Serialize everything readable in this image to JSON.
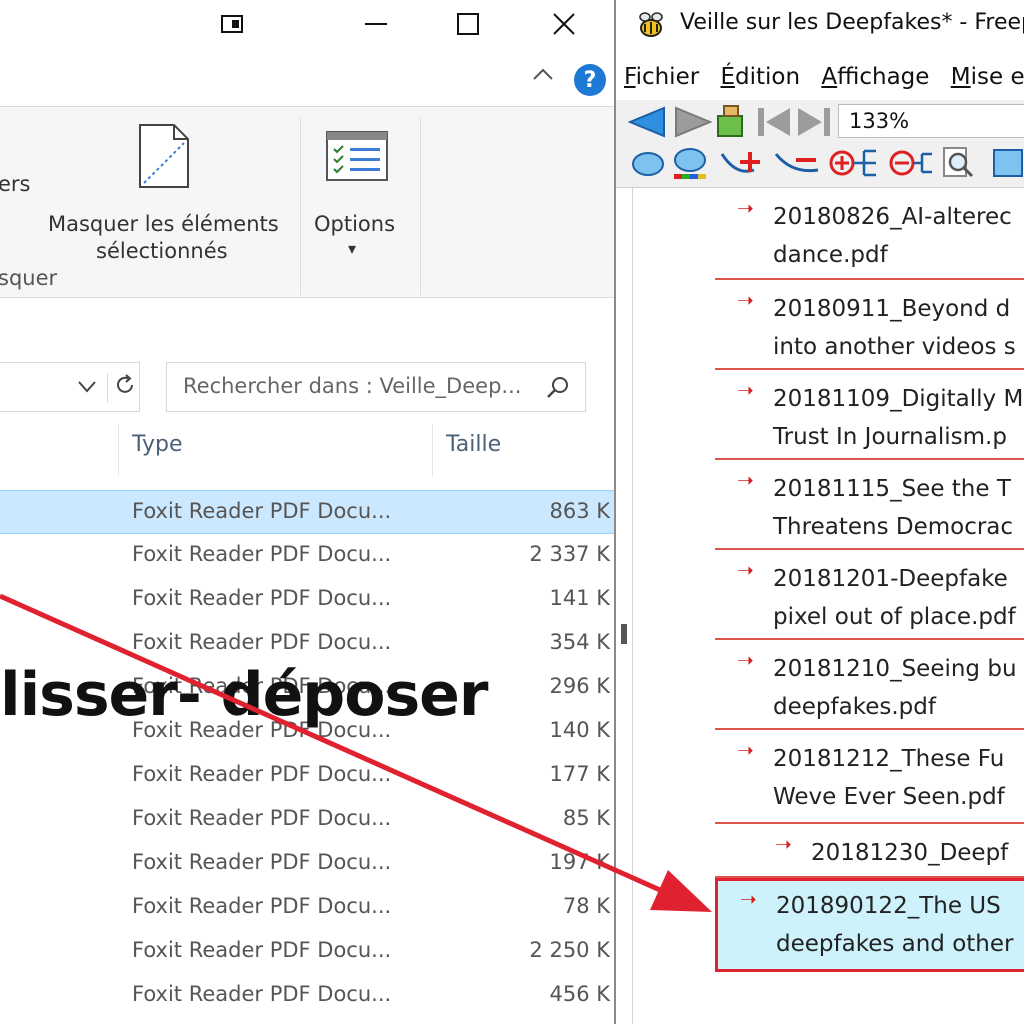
{
  "explorer": {
    "ribbon": {
      "partial_label": "ers",
      "hide_button_line1": "Masquer les éléments",
      "hide_button_line2": "sélectionnés",
      "group_label": "squer",
      "options_label": "Options",
      "options_caret": "▾"
    },
    "search": {
      "placeholder": "Rechercher dans : Veille_Deep..."
    },
    "columns": {
      "type": "Type",
      "size": "Taille"
    },
    "rows": [
      {
        "type": "Foxit Reader PDF Docu...",
        "size": "863 K",
        "selected": true
      },
      {
        "type": "Foxit Reader PDF Docu...",
        "size": "2 337 K"
      },
      {
        "type": "Foxit Reader PDF Docu...",
        "size": "141 K"
      },
      {
        "type": "Foxit Reader PDF Docu...",
        "size": "354 K"
      },
      {
        "type": "Foxit Reader PDF Docu...",
        "size": "296 K"
      },
      {
        "type": "Foxit Reader PDF Docu...",
        "size": "140 K"
      },
      {
        "type": "Foxit Reader PDF Docu...",
        "size": "177 K"
      },
      {
        "type": "Foxit Reader PDF Docu...",
        "size": "85 K"
      },
      {
        "type": "Foxit Reader PDF Docu...",
        "size": "197 K"
      },
      {
        "type": "Foxit Reader PDF Docu...",
        "size": "78 K"
      },
      {
        "type": "Foxit Reader PDF Docu...",
        "size": "2 250 K"
      },
      {
        "type": "Foxit Reader PDF Docu...",
        "size": "456 K"
      }
    ]
  },
  "overlay": {
    "drag_label": "lisser- déposer",
    "arrow_color": "#e0212f"
  },
  "freeplane": {
    "title": "Veille sur les Deepfakes* - Freep",
    "menu": [
      {
        "u": "F",
        "rest": "ichier"
      },
      {
        "u": "É",
        "rest": "dition"
      },
      {
        "u": "A",
        "rest": "ffichage"
      },
      {
        "u": "M",
        "rest": "ise en"
      }
    ],
    "zoom": "133%",
    "nodes": [
      {
        "line1": "20180826_AI-alterec",
        "line2": "dance.pdf"
      },
      {
        "line1": "20180911_Beyond d",
        "line2": "into another videos s"
      },
      {
        "line1": "20181109_Digitally M",
        "line2": "Trust In Journalism.p"
      },
      {
        "line1": "20181115_See the T",
        "line2": "Threatens Democrac"
      },
      {
        "line1": "20181201-Deepfake",
        "line2": "pixel out of place.pdf"
      },
      {
        "line1": "20181210_Seeing bu",
        "line2": "deepfakes.pdf"
      },
      {
        "line1": "20181212_These Fu",
        "line2": "Weve Ever Seen.pdf"
      },
      {
        "line1": "20181230_Deepf",
        "line2": ""
      },
      {
        "line1": "201890122_The US",
        "line2": "deepfakes and other"
      }
    ]
  }
}
